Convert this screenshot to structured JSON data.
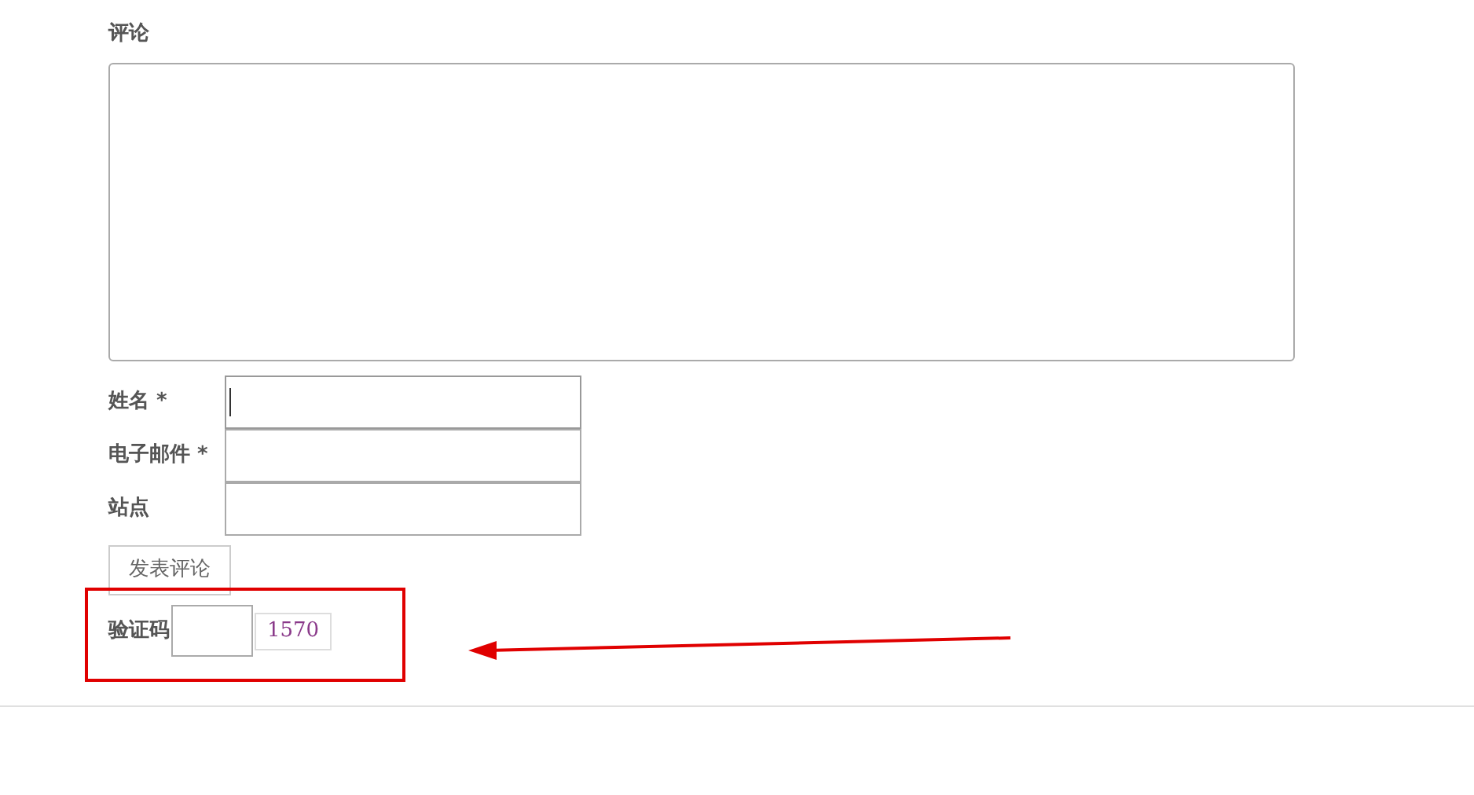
{
  "comment": {
    "label": "评论"
  },
  "fields": [
    {
      "label": "姓名 *",
      "focused": true
    },
    {
      "label": "电子邮件 *",
      "focused": false
    },
    {
      "label": "站点",
      "focused": false
    }
  ],
  "submit_button": "发表评论",
  "captcha": {
    "label": "验证码",
    "code": "1570"
  }
}
